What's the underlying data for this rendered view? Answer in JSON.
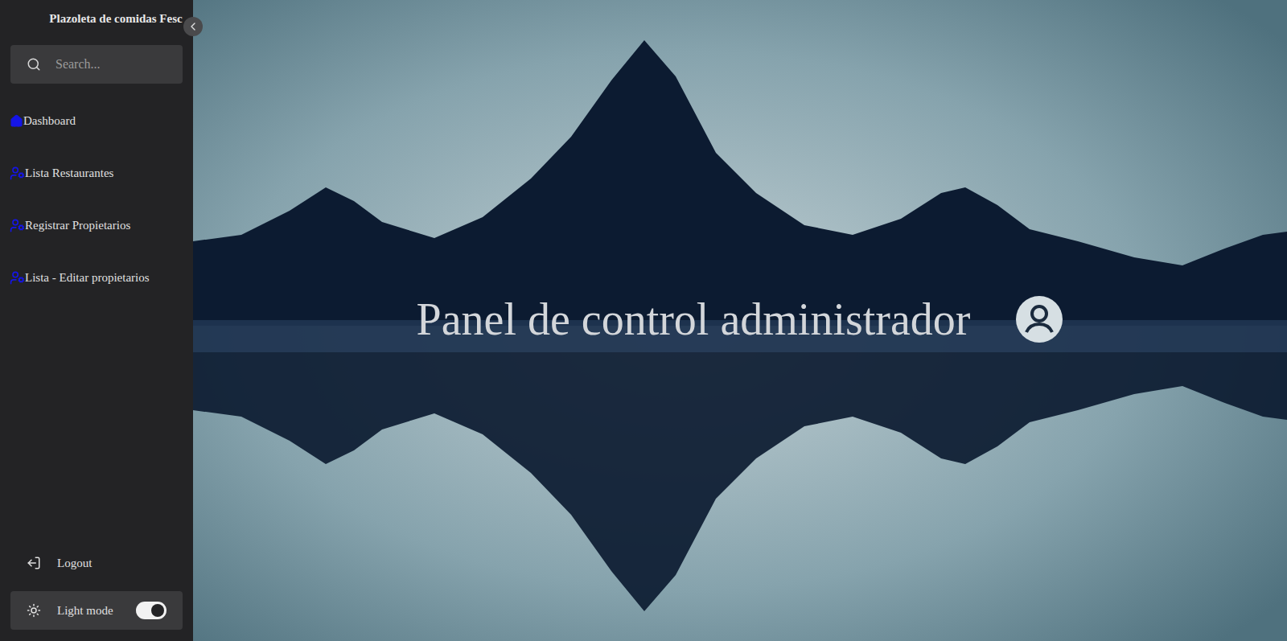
{
  "sidebar": {
    "title": "Plazoleta de comidas Fesc",
    "search": {
      "placeholder": "Search..."
    },
    "items": [
      {
        "label": "Dashboard"
      },
      {
        "label": "Lista Restaurantes"
      },
      {
        "label": "Registrar Propietarios"
      },
      {
        "label": "Lista - Editar propietarios"
      }
    ],
    "logout": {
      "label": "Logout"
    },
    "theme_toggle": {
      "label": "Light mode",
      "on": true
    }
  },
  "main": {
    "heading": "Panel de control administrador"
  }
}
